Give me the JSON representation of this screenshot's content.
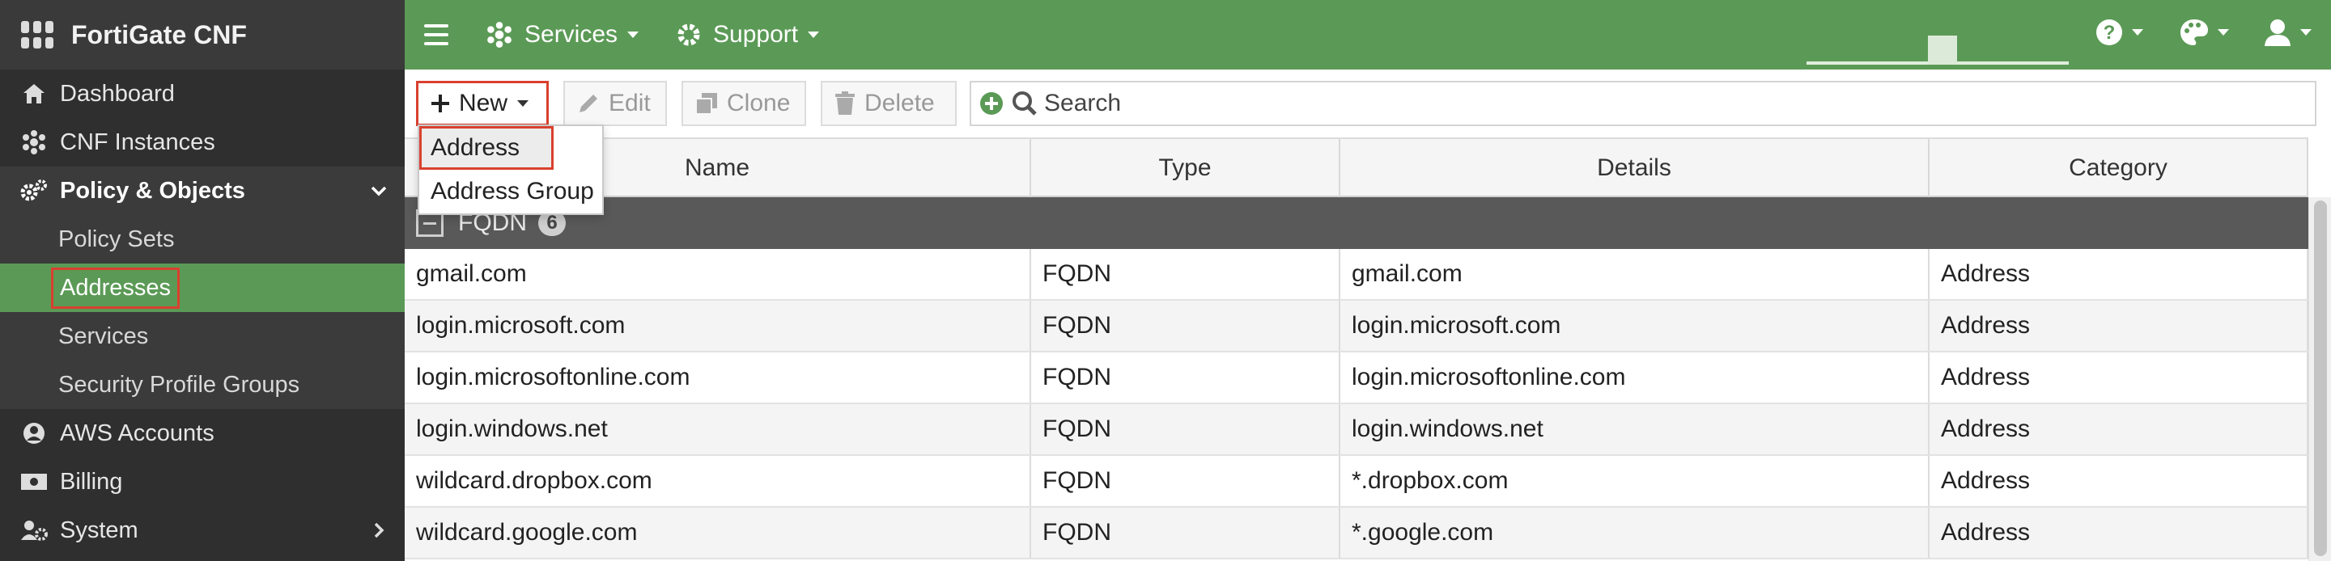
{
  "app": {
    "title": "FortiGate CNF"
  },
  "sidebar": {
    "items": [
      {
        "label": "Dashboard",
        "icon": "home-icon"
      },
      {
        "label": "CNF Instances",
        "icon": "cluster-icon"
      },
      {
        "label": "Policy & Objects",
        "icon": "gears-icon",
        "expanded": true
      },
      {
        "label": "AWS Accounts",
        "icon": "user-circle-icon"
      },
      {
        "label": "Billing",
        "icon": "money-icon"
      },
      {
        "label": "System",
        "icon": "users-cog-icon"
      }
    ],
    "subitems": [
      {
        "label": "Policy Sets"
      },
      {
        "label": "Addresses",
        "active": true
      },
      {
        "label": "Services"
      },
      {
        "label": "Security Profile Groups"
      }
    ]
  },
  "topbar": {
    "menu_icon": "hamburger-icon",
    "services_label": "Services",
    "support_label": "Support",
    "help_icon": "question-circle-icon",
    "theme_icon": "palette-icon",
    "user_icon": "user-icon"
  },
  "toolbar": {
    "new_label": "New",
    "edit_label": "Edit",
    "clone_label": "Clone",
    "delete_label": "Delete",
    "search_placeholder": "Search"
  },
  "new_menu": {
    "items": [
      "Address",
      "Address Group"
    ],
    "highlighted": "Address"
  },
  "table": {
    "columns": [
      "Name",
      "Type",
      "Details",
      "Category"
    ],
    "group": {
      "label": "FQDN",
      "count": "6"
    },
    "rows": [
      [
        "gmail.com",
        "FQDN",
        "gmail.com",
        "Address"
      ],
      [
        "login.microsoft.com",
        "FQDN",
        "login.microsoft.com",
        "Address"
      ],
      [
        "login.microsoftonline.com",
        "FQDN",
        "login.microsoftonline.com",
        "Address"
      ],
      [
        "login.windows.net",
        "FQDN",
        "login.windows.net",
        "Address"
      ],
      [
        "wildcard.dropbox.com",
        "FQDN",
        "*.dropbox.com",
        "Address"
      ],
      [
        "wildcard.google.com",
        "FQDN",
        "*.google.com",
        "Address"
      ]
    ]
  },
  "colors": {
    "accent_green": "#5b9a56",
    "sidebar_bg": "#2f2f2f",
    "highlight_red": "#d9402f",
    "group_row_bg": "#595959"
  }
}
